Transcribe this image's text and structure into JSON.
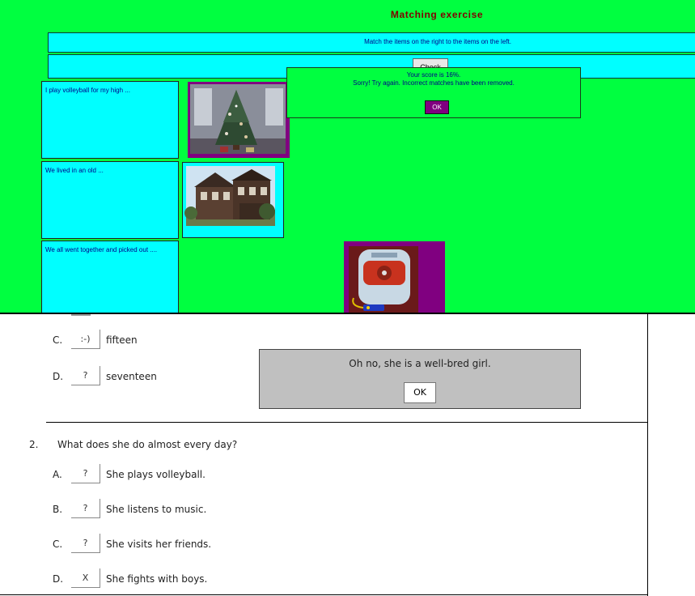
{
  "matching": {
    "title": "Matching exercise",
    "instruction": "Match the items on the right to the items on the left.",
    "check_label": "Check",
    "items": [
      {
        "text": "I play volleyball for my high ..."
      },
      {
        "text": "We lived in an old ..."
      },
      {
        "text": "We all went together and picked out ...."
      }
    ],
    "score_popup": {
      "score": "Your score is 16%.",
      "message": "Sorry! Try again. Incorrect matches have been removed.",
      "ok_label": "OK"
    },
    "colors": {
      "background": "#00ff40",
      "panel": "#00ffff",
      "accent": "#800080",
      "title": "#800000"
    }
  },
  "quiz": {
    "q1_options": [
      {
        "letter": "C.",
        "mark": ":-)",
        "text": "fifteen"
      },
      {
        "letter": "D.",
        "mark": "?",
        "text": "seventeen"
      }
    ],
    "feedback": {
      "message": "Oh no, she is a well-bred girl.",
      "ok_label": "OK"
    },
    "q2": {
      "number": "2.",
      "text": "What does she do almost every day?",
      "options": [
        {
          "letter": "A.",
          "mark": "?",
          "text": "She plays volleyball."
        },
        {
          "letter": "B.",
          "mark": "?",
          "text": "She listens to music."
        },
        {
          "letter": "C.",
          "mark": "?",
          "text": "She visits her friends."
        },
        {
          "letter": "D.",
          "mark": "X",
          "text": "She fights with boys."
        }
      ]
    }
  }
}
